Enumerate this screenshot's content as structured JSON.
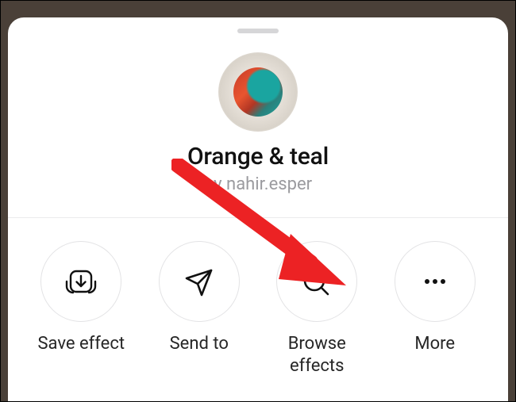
{
  "effect": {
    "title": "Orange & teal",
    "by_prefix": "by ",
    "author": "nahir.esper"
  },
  "actions": {
    "save": {
      "label": "Save effect",
      "icon": "save-icon"
    },
    "send": {
      "label": "Send to",
      "icon": "paper-plane-icon"
    },
    "browse": {
      "label": "Browse effects",
      "icon": "browse-effects-icon"
    },
    "more": {
      "label": "More",
      "icon": "more-icon"
    }
  },
  "colors": {
    "arrow": "#EC2224",
    "circle_border": "#e3e3e5",
    "subtitle": "#9b9b9f"
  }
}
